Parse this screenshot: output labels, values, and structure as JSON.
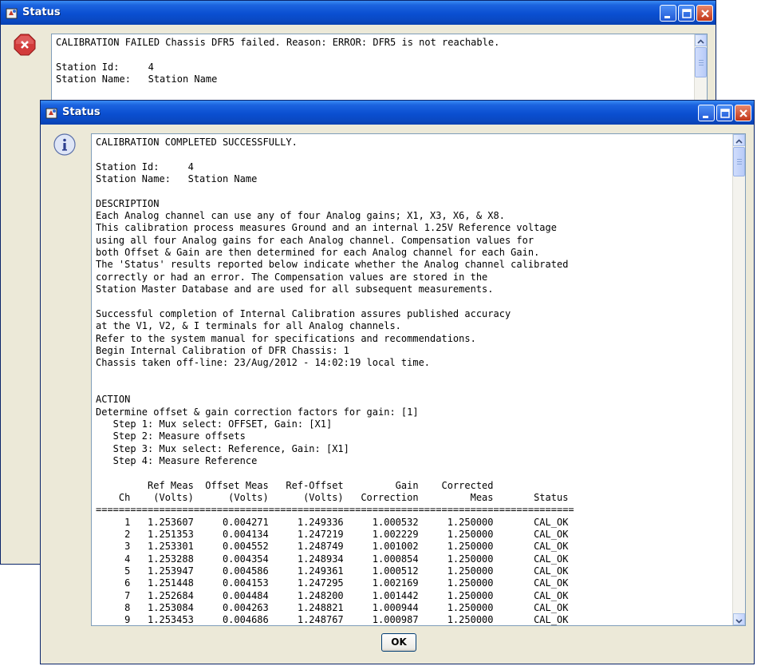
{
  "back_window": {
    "title": "Status",
    "icon": "error-icon",
    "text_lines": [
      "CALIBRATION FAILED Chassis DFR5 failed. Reason: ERROR: DFR5 is not reachable.",
      "",
      "Station Id:     4",
      "Station Name:   Station Name"
    ]
  },
  "front_window": {
    "title": "Status",
    "icon": "info-icon",
    "ok_label": "OK",
    "text_lines": [
      "CALIBRATION COMPLETED SUCCESSFULLY.",
      "",
      "Station Id:     4",
      "Station Name:   Station Name",
      "",
      "DESCRIPTION",
      "Each Analog channel can use any of four Analog gains; X1, X3, X6, & X8.",
      "This calibration process measures Ground and an internal 1.25V Reference voltage",
      "using all four Analog gains for each Analog channel. Compensation values for",
      "both Offset & Gain are then determined for each Analog channel for each Gain.",
      "The 'Status' results reported below indicate whether the Analog channel calibrated",
      "correctly or had an error. The Compensation values are stored in the",
      "Station Master Database and are used for all subsequent measurements.",
      "",
      "Successful completion of Internal Calibration assures published accuracy",
      "at the V1, V2, & I terminals for all Analog channels.",
      "Refer to the system manual for specifications and recommendations.",
      "Begin Internal Calibration of DFR Chassis: 1",
      "Chassis taken off-line: 23/Aug/2012 - 14:02:19 local time.",
      "",
      "",
      "ACTION",
      "Determine offset & gain correction factors for gain: [1]",
      "   Step 1: Mux select: OFFSET, Gain: [X1]",
      "   Step 2: Measure offsets",
      "   Step 3: Mux select: Reference, Gain: [X1]",
      "   Step 4: Measure Reference",
      "",
      "         Ref Meas  Offset Meas   Ref-Offset         Gain    Corrected",
      "    Ch    (Volts)      (Volts)      (Volts)   Correction         Meas       Status",
      "===================================================================================",
      "     1   1.253607     0.004271     1.249336     1.000532     1.250000       CAL_OK",
      "     2   1.251353     0.004134     1.247219     1.002229     1.250000       CAL_OK",
      "     3   1.253301     0.004552     1.248749     1.001002     1.250000       CAL_OK",
      "     4   1.253288     0.004354     1.248934     1.000854     1.250000       CAL_OK",
      "     5   1.253947     0.004586     1.249361     1.000512     1.250000       CAL_OK",
      "     6   1.251448     0.004153     1.247295     1.002169     1.250000       CAL_OK",
      "     7   1.252684     0.004484     1.248200     1.001442     1.250000       CAL_OK",
      "     8   1.253084     0.004263     1.248821     1.000944     1.250000       CAL_OK",
      "     9   1.253453     0.004686     1.248767     1.000987     1.250000       CAL_OK"
    ]
  }
}
